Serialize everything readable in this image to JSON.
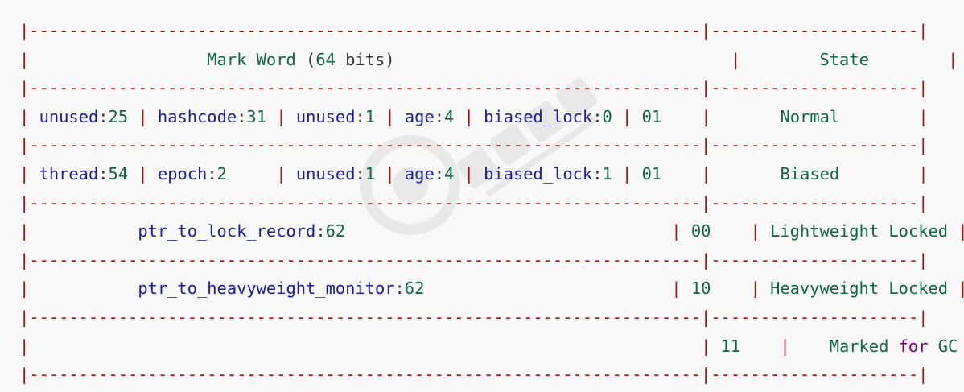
{
  "colors": {
    "background": "#f8f8f8",
    "border": "#aa1111",
    "identifier": "#1a1aa6",
    "number_string": "#116644",
    "keyword": "#770088",
    "plain": "#333333"
  },
  "separator": "|--------------------------------------------------------------------|---------------------|",
  "header": {
    "mark_word_prefix": "Mark Word",
    "open_paren": "(",
    "bits_number": "64",
    "bits_word": "bits)",
    "state": "State"
  },
  "rows": [
    {
      "cells": [
        {
          "name": "unused",
          "value": "25"
        },
        {
          "name": "hashcode",
          "value": "31"
        },
        {
          "name": "unused",
          "value": "1"
        },
        {
          "name": "age",
          "value": "4"
        },
        {
          "name": "biased_lock",
          "value": "0"
        }
      ],
      "lock_bits": "01",
      "state": "Normal"
    },
    {
      "cells": [
        {
          "name": "thread",
          "value": "54"
        },
        {
          "name": "epoch",
          "value": "2"
        },
        {
          "name": "unused",
          "value": "1"
        },
        {
          "name": "age",
          "value": "4"
        },
        {
          "name": "biased_lock",
          "value": "1"
        }
      ],
      "lock_bits": "01",
      "state": "Biased"
    },
    {
      "field": {
        "name": "ptr_to_lock_record",
        "value": "62"
      },
      "lock_bits": "00",
      "state": "Lightweight Locked"
    },
    {
      "field": {
        "name": "ptr_to_heavyweight_monitor",
        "value": "62"
      },
      "lock_bits": "10",
      "state": "Heavyweight Locked"
    },
    {
      "lock_bits": "11",
      "state_parts": [
        "Marked",
        "for",
        "GC"
      ]
    }
  ]
}
